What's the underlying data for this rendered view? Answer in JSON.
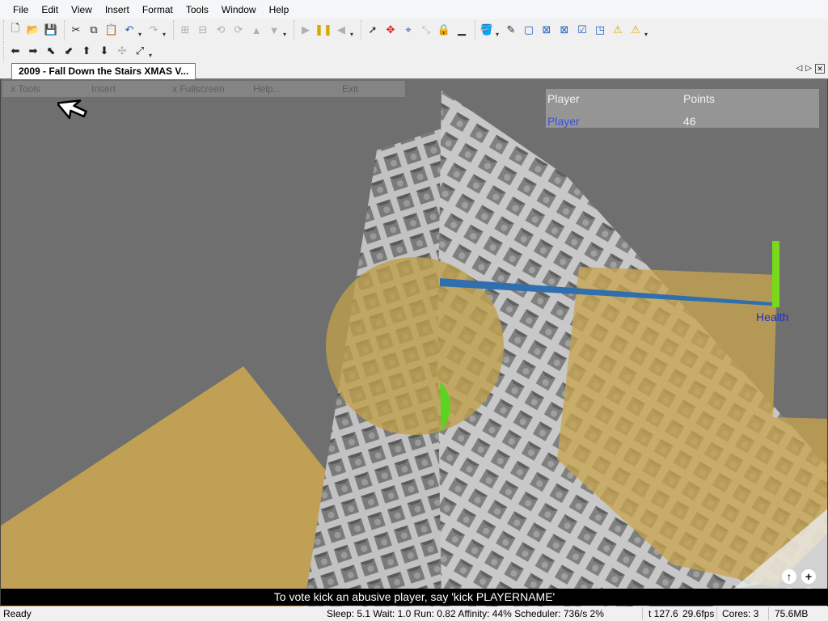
{
  "menubar": {
    "items": [
      "File",
      "Edit",
      "View",
      "Insert",
      "Format",
      "Tools",
      "Window",
      "Help"
    ]
  },
  "toolbar1": {
    "groups": [
      [
        "new-icon",
        "open-icon",
        "save-icon"
      ],
      [
        "cut-icon",
        "copy-icon",
        "paste-icon",
        "undo-icon",
        "redo-icon"
      ],
      [
        "group-icon",
        "ungroup-icon",
        "rotate-left-icon",
        "rotate-right-icon",
        "move-up-icon",
        "move-down-icon"
      ],
      [
        "play-icon",
        "pause-icon",
        "step-back-icon"
      ],
      [
        "select-icon",
        "move-icon",
        "transform-icon",
        "scale-icon",
        "lock-icon",
        "ground-icon"
      ],
      [
        "paint-icon",
        "eyedropper-icon",
        "box-icon",
        "box-x-icon",
        "box-x2-icon",
        "box-check-icon",
        "box-corner-icon",
        "warning-up-icon",
        "warning-icon"
      ]
    ]
  },
  "toolbar2": {
    "arrows": [
      "arrow-left-icon",
      "arrow-right-icon",
      "arrow-up-left-icon",
      "arrow-down-left-icon",
      "arrow-up-icon",
      "arrow-down-icon",
      "crosshair-icon",
      "expand-icon"
    ]
  },
  "tab": {
    "title": "2009 - Fall Down the Stairs XMAS V..."
  },
  "game_menu": {
    "items": [
      "x Tools",
      "Insert",
      "x Fullscreen",
      "Help...",
      "Exit"
    ]
  },
  "score": {
    "headers": [
      "Player",
      "Points"
    ],
    "player": "Player",
    "points": "46",
    "player_color": "#3b4fe0"
  },
  "health": {
    "label": "Health",
    "level": 1.0,
    "color": "#78d81a"
  },
  "chat": {
    "message": "To vote kick an abusive player, say 'kick PLAYERNAME'"
  },
  "status": {
    "ready": "Ready",
    "stats": "Sleep: 5.1 Wait: 1.0 Run: 0.82 Affinity: 44% Scheduler: 736/s 2%",
    "time": "t 127.6",
    "fps": "29.6fps",
    "cores": "Cores: 3",
    "memory": "75.6MB"
  }
}
